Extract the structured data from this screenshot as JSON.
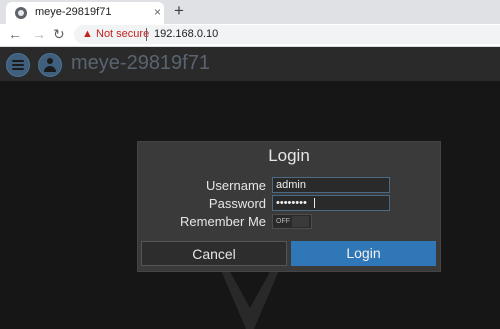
{
  "browser": {
    "tab_title": "meye-29819f71",
    "tab_close_glyph": "×",
    "new_tab_glyph": "+",
    "back_glyph": "←",
    "forward_glyph": "→",
    "reload_glyph": "↻",
    "security_icon_glyph": "▲",
    "security_label": "Not secure",
    "url": "192.168.0.10"
  },
  "header": {
    "title": "meye-29819f71",
    "accent_color": "#3f5f7d"
  },
  "login": {
    "title": "Login",
    "username_label": "Username",
    "username_value": "admin",
    "password_label": "Password",
    "password_value": "••••••••",
    "remember_label": "Remember Me",
    "remember_state": "OFF",
    "cancel_label": "Cancel",
    "login_label": "Login",
    "login_color": "#2f77b6"
  }
}
